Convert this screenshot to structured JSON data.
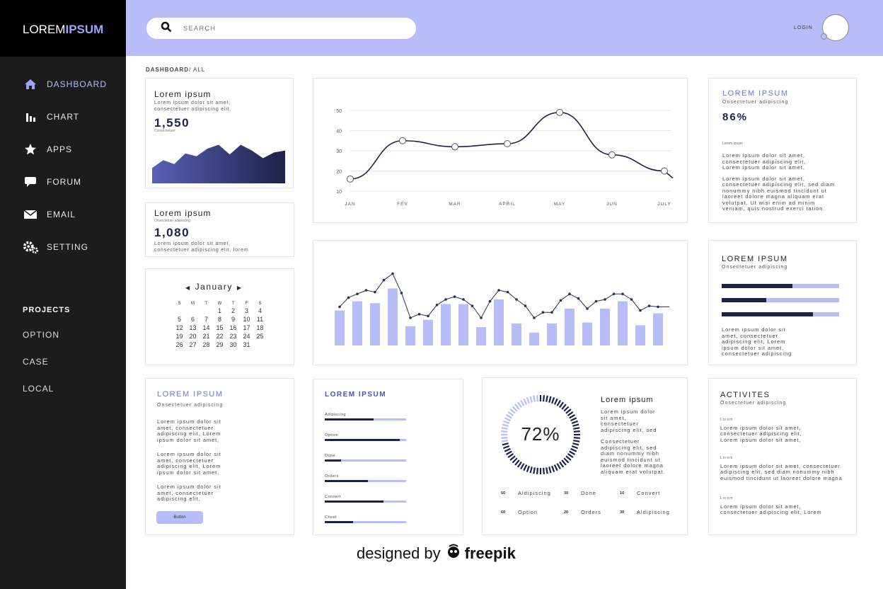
{
  "brand": {
    "name_regular": "LOREM",
    "name_bold": "IPSUM"
  },
  "sidebar": {
    "items": [
      {
        "label": "DASHBOARD",
        "icon": "home-icon"
      },
      {
        "label": "CHART",
        "icon": "bar-chart-icon"
      },
      {
        "label": "APPS",
        "icon": "star-icon"
      },
      {
        "label": "FORUM",
        "icon": "chat-icon"
      },
      {
        "label": "EMAIL",
        "icon": "mail-icon"
      },
      {
        "label": "SETTING",
        "icon": "gears-icon"
      }
    ],
    "projects_label": "PROJECTS",
    "sub_items": [
      "OPTION",
      "CASE",
      "LOCAL"
    ]
  },
  "header": {
    "search_placeholder": "SEARCH",
    "login_label": "LOGIN"
  },
  "breadcrumb": {
    "current": "DASHBOARD",
    "rest": "/ ALL"
  },
  "stat1": {
    "title": "Lorem ipsum",
    "text1": "Lorem ipsum dolor sit amet,",
    "text2": "consectetuer adipiscing elit,",
    "value": "1,550",
    "caption": "Consectetuer",
    "area_values": [
      16,
      24,
      20,
      31,
      28,
      36,
      40,
      30,
      40,
      34,
      26,
      32,
      34
    ]
  },
  "stat2": {
    "title": "Lorem ipsum",
    "caption": "Onsectetuer adipiscing",
    "value": "1,080",
    "text1": "Lorem ipsum dolor sit amet,",
    "text2": "consectetuer adipiscing elit, lorem"
  },
  "calendar": {
    "month": "January",
    "dow": [
      "S",
      "M",
      "T",
      "W",
      "T",
      "F",
      "S"
    ],
    "days": [
      "",
      "",
      "",
      "1",
      "2",
      "3",
      "4",
      "5",
      "6",
      "7",
      "8",
      "9",
      "10",
      "11",
      "12",
      "13",
      "14",
      "15",
      "16",
      "17",
      "18",
      "19",
      "20",
      "21",
      "22",
      "23",
      "24",
      "25",
      "26",
      "27",
      "28",
      "29",
      "30",
      "31"
    ]
  },
  "chart_data": [
    {
      "type": "line",
      "x": [
        "JAN",
        "FEV",
        "MAR",
        "APRIL",
        "MAY",
        "JUN",
        "JULY"
      ],
      "y_ticks": [
        50,
        40,
        30,
        20,
        10
      ],
      "ylim": [
        10,
        50
      ],
      "series": [
        {
          "values": [
            16,
            35,
            32,
            33.5,
            49,
            28,
            20
          ]
        }
      ],
      "grid": true
    },
    {
      "type": "bar",
      "series": [
        {
          "values": [
            38,
            48,
            46,
            62,
            21,
            28,
            45,
            45,
            20,
            50,
            24,
            14,
            24,
            40,
            25,
            40,
            48,
            22,
            35
          ]
        },
        {
          "values": [
            42,
            56,
            58,
            78,
            30,
            32,
            50,
            50,
            30,
            60,
            50,
            30,
            36,
            56,
            40,
            50,
            56,
            38,
            42
          ]
        }
      ]
    }
  ],
  "percent_card": {
    "title": "LOREM IPSUM",
    "caption": "Onsectetuer adipiscing",
    "value": "86%",
    "label": "Lorem ipsum",
    "text1": "Lorem ipsum dolor sit amet,",
    "text2": "consectetuer adipiscing elit,",
    "text3": "Lorem ipsum dolor sit amet,",
    "text4": "Lorem ipsum dolor sit amet,",
    "text5": "consectetuer adipiscing elit, sed diam",
    "text6": "nonummy nibh euismod tincidunt ut",
    "text7": "laoreet dolore magna aliquam erat",
    "text8": "volutpat. Ut wisi enim ad minim",
    "text9": "veniam, quis nostrud exerci tation"
  },
  "bars_card": {
    "title": "LOREM IPSUM",
    "caption": "Onsectetuer adipiscing",
    "fills": [
      0.6,
      0.38,
      0.78
    ],
    "text1": "Lorem ipsum dolor sit",
    "text2": "amet, consectetuer",
    "text3": "adipiscing elit, Lorem",
    "text4": "ipsum dolor sit amet,",
    "text5": "consectetuer adipiscing"
  },
  "text_card": {
    "title": "LOREM IPSUM",
    "caption": "Onsectetuer adipiscing",
    "p1": [
      "Lorem ipsum dolor sit",
      "amet, consectetuer",
      "adipiscing elit, Lorem",
      "ipsum dolor sit amet,"
    ],
    "p2": [
      "Lorem ipsum dolor sit",
      "amet, consectetuer",
      "adipiscing elit, Lorem",
      "ipsum dolor sit amet,"
    ],
    "p3": [
      "Lorem ipsum dolor sit",
      "amet, consectetuer",
      "adipiscing elit,"
    ],
    "button": "Button"
  },
  "progress_card": {
    "title": "LOREM IPSUM",
    "items": [
      {
        "label": "Adipiscing",
        "value": 0.6
      },
      {
        "label": "Option",
        "value": 0.92
      },
      {
        "label": "Done",
        "value": 0.2
      },
      {
        "label": "Orders",
        "value": 0.53
      },
      {
        "label": "Convert",
        "value": 0.72
      },
      {
        "label": "Cheet",
        "value": 0.35
      }
    ]
  },
  "donut_card": {
    "value": "72%",
    "percent": 0.72,
    "title": "Lorem ipsum",
    "text1": "Lorem ipsum dolor",
    "text2": "sit amet,",
    "text3": "consectetuer",
    "text4": "adipiscing elit, sed",
    "text5": "Consectetuer",
    "text6": "adipiscing elit, sed",
    "text7": "diam nonummy nibh",
    "text8": "euismod tincidunt ut",
    "text9": "laoreet dolore magna",
    "text10": "aliquam erat volutpat.",
    "stats": [
      {
        "n": "50",
        "label": "Aldipiscing"
      },
      {
        "n": "30",
        "label": "Done"
      },
      {
        "n": "10",
        "label": "Convert"
      },
      {
        "n": "60",
        "label": "Option"
      },
      {
        "n": "20",
        "label": "Orders"
      },
      {
        "n": "30",
        "label": "Aldipiscing"
      }
    ]
  },
  "activities": {
    "title": "ACTIVITES",
    "caption": "Onsectetuer adipiscing",
    "groups": [
      {
        "head": "Lorem",
        "lines": [
          "Lorem ipsum dolor sit amet,",
          "consectetuer adipiscing elit,",
          "Lorem ipsum dolor sit amet,"
        ]
      },
      {
        "head": "Lorem",
        "lines": [
          "Lorem ipsum dolor sit amet, consectetuer",
          "adipiscing elit, sed diam nonummy nibh",
          "euismod tincidunt ut laoreet dolore magna"
        ]
      },
      {
        "head": "Lorem",
        "lines": [
          "Lorem ipsum dolor sit amet,",
          "consectetuer adipiscing elit, Lorem"
        ]
      }
    ]
  },
  "footer": {
    "prefix": "designed by",
    "brand": "freepik"
  },
  "colors": {
    "accent": "#b8bdf9",
    "dark": "#1e2148",
    "sidebar": "#1c1c1c"
  }
}
